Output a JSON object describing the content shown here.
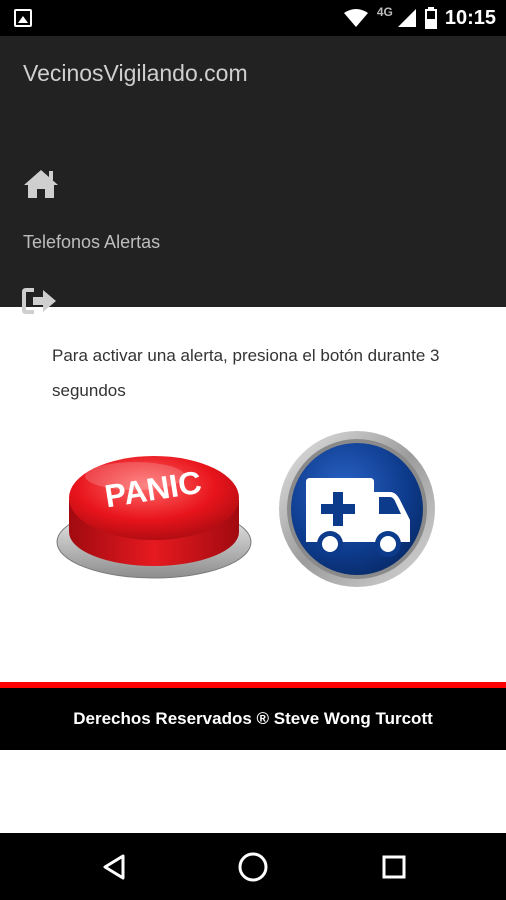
{
  "status_bar": {
    "time": "10:15",
    "network": "4G"
  },
  "header": {
    "brand": "VecinosVigilando.com",
    "nav_link": "Telefonos Alertas"
  },
  "main": {
    "instruction": "Para activar una alerta, presiona el botón durante 3 segundos",
    "panic_label": "PANIC"
  },
  "footer": {
    "text": "Derechos Reservados ® Steve Wong Turcott"
  },
  "colors": {
    "nav_bg": "#222222",
    "accent_red": "#ff0000",
    "panic_red": "#e8141b",
    "ambulance_blue": "#0d3b8c"
  }
}
